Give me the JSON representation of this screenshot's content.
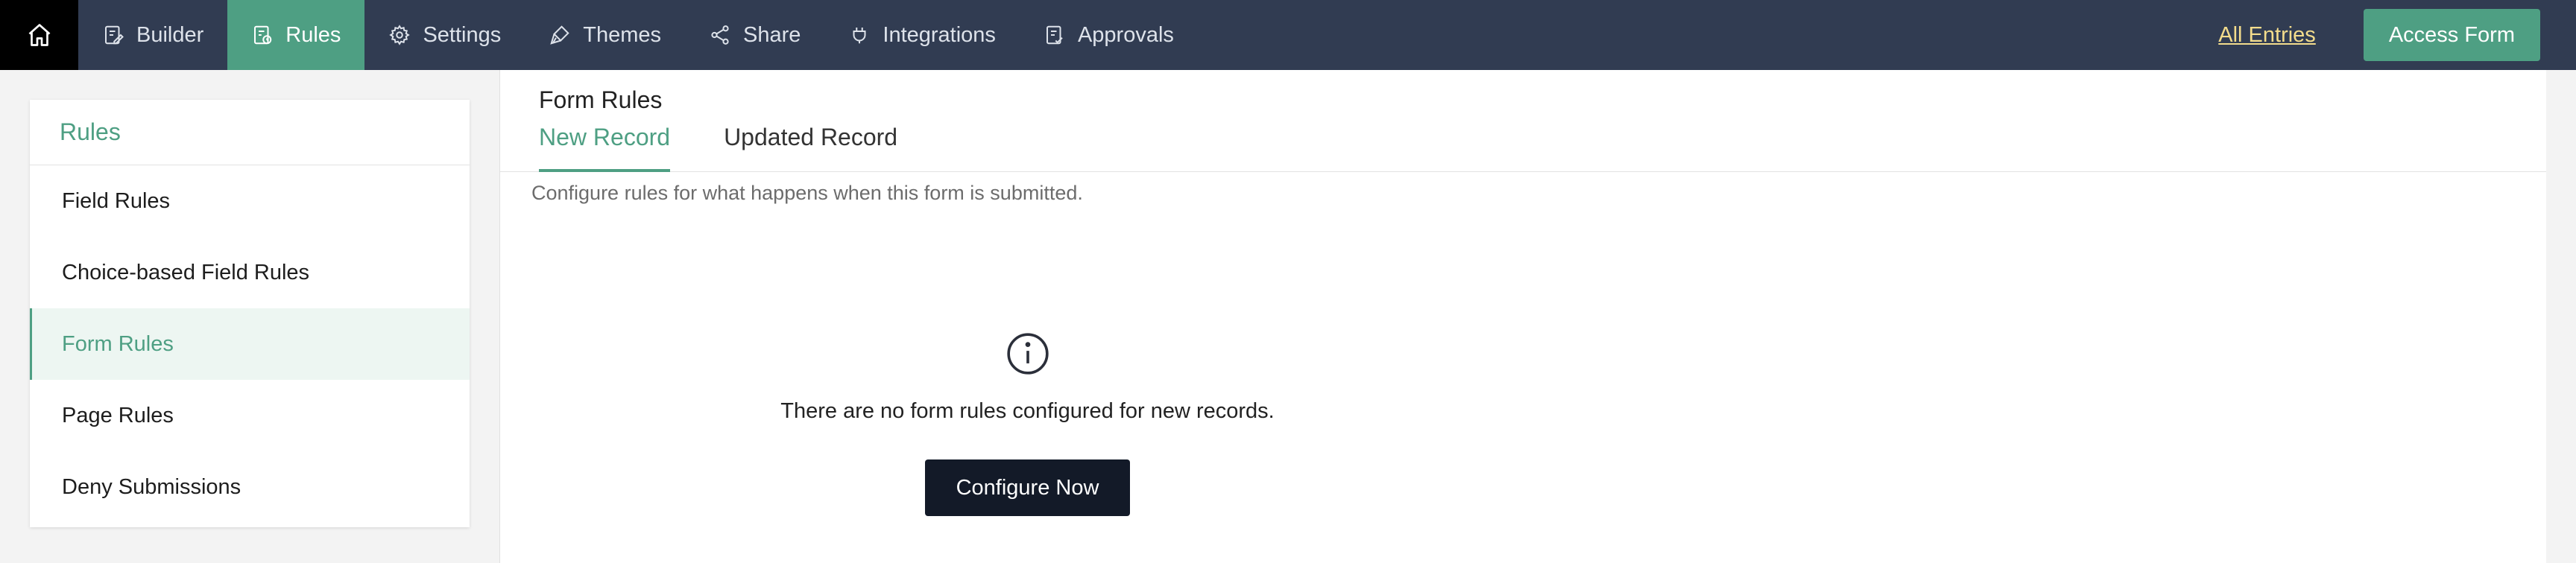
{
  "nav": {
    "items": [
      {
        "label": "Builder",
        "icon": "builder-icon"
      },
      {
        "label": "Rules",
        "icon": "rules-icon"
      },
      {
        "label": "Settings",
        "icon": "gear-icon"
      },
      {
        "label": "Themes",
        "icon": "brush-icon"
      },
      {
        "label": "Share",
        "icon": "share-icon"
      },
      {
        "label": "Integrations",
        "icon": "plug-icon"
      },
      {
        "label": "Approvals",
        "icon": "approvals-icon"
      }
    ],
    "active": "Rules",
    "all_entries": "All Entries",
    "access_form": "Access Form"
  },
  "sidebar": {
    "title": "Rules",
    "items": [
      {
        "label": "Field Rules"
      },
      {
        "label": "Choice-based Field Rules"
      },
      {
        "label": "Form Rules"
      },
      {
        "label": "Page Rules"
      },
      {
        "label": "Deny Submissions"
      }
    ],
    "active": "Form Rules"
  },
  "main": {
    "title": "Form Rules",
    "tabs": [
      {
        "label": "New Record"
      },
      {
        "label": "Updated Record"
      }
    ],
    "active_tab": "New Record",
    "description": "Configure rules for what happens when this form is submitted.",
    "empty_text": "There are no form rules configured for new records.",
    "configure_label": "Configure Now"
  },
  "colors": {
    "nav_bg": "#313c52",
    "accent": "#4e9f83",
    "link": "#f3dc8c",
    "dark_button": "#131a28"
  }
}
